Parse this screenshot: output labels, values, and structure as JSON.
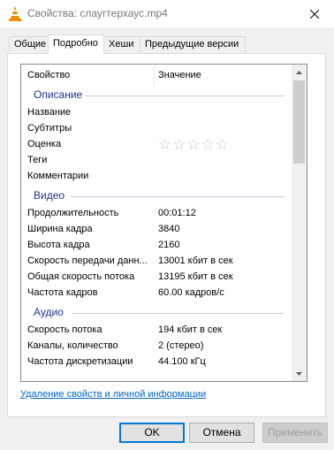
{
  "window": {
    "title": "Свойства: слаугтерхаус.mp4",
    "close_icon": "close-icon",
    "app_icon": "vlc-cone-icon"
  },
  "tabs": [
    {
      "label": "Общие",
      "active": false
    },
    {
      "label": "Подробно",
      "active": true
    },
    {
      "label": "Хеши",
      "active": false
    },
    {
      "label": "Предыдущие версии",
      "active": false
    }
  ],
  "columns": {
    "property": "Свойство",
    "value": "Значение"
  },
  "groups": {
    "description": {
      "label": "Описание",
      "rows": [
        {
          "name": "Название",
          "value": ""
        },
        {
          "name": "Субтитры",
          "value": ""
        },
        {
          "name": "Оценка",
          "rating_stars": 0,
          "rating_max": 5
        },
        {
          "name": "Теги",
          "value": ""
        },
        {
          "name": "Комментарии",
          "value": ""
        }
      ]
    },
    "video": {
      "label": "Видео",
      "rows": [
        {
          "name": "Продолжительность",
          "value": "00:01:12"
        },
        {
          "name": "Ширина кадра",
          "value": "3840"
        },
        {
          "name": "Высота кадра",
          "value": "2160"
        },
        {
          "name": "Скорость передачи данн...",
          "value": "13001 кбит в сек"
        },
        {
          "name": "Общая скорость потока",
          "value": "13195 кбит в сек"
        },
        {
          "name": "Частота кадров",
          "value": "60.00 кадров/с"
        }
      ]
    },
    "audio": {
      "label": "Аудио",
      "rows": [
        {
          "name": "Скорость потока",
          "value": "194 кбит в сек"
        },
        {
          "name": "Каналы, количество",
          "value": "2 (стерео)"
        },
        {
          "name": "Частота дискретизации",
          "value": "44.100 кГц"
        }
      ]
    }
  },
  "remove_link": "Удаление свойств и личной информации",
  "buttons": {
    "ok": "OK",
    "cancel": "Отмена",
    "apply": "Применить"
  },
  "colors": {
    "group_header": "#1e3287",
    "link": "#0066cc",
    "accent": "#0078d7"
  }
}
